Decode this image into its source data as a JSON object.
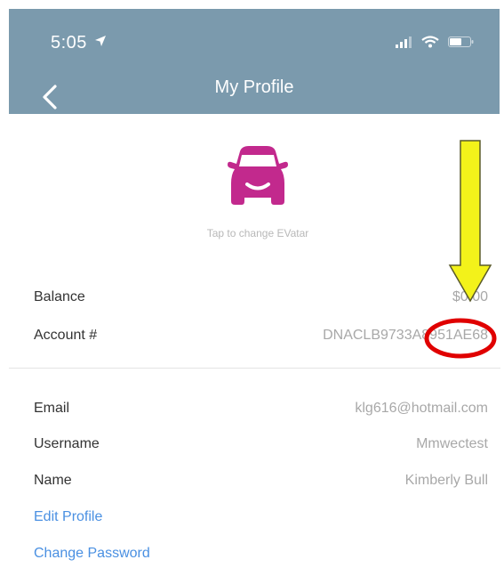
{
  "status_bar": {
    "time": "5:05"
  },
  "nav": {
    "title": "My Profile"
  },
  "avatar": {
    "caption": "Tap to change EVatar"
  },
  "account": {
    "balance_label": "Balance",
    "balance_value": "$0.00",
    "account_label": "Account #",
    "account_value": "DNACLB9733A8951AE68"
  },
  "profile": {
    "email_label": "Email",
    "email_value": "klg616@hotmail.com",
    "username_label": "Username",
    "username_value": "Mmwectest",
    "name_label": "Name",
    "name_value": "Kimberly Bull"
  },
  "actions": {
    "edit_profile": "Edit Profile",
    "change_password": "Change Password"
  },
  "colors": {
    "header_bg": "#7b9aad",
    "accent_link": "#4a90e2",
    "avatar_magenta": "#c2298d",
    "annotation_arrow": "#f3f21a",
    "annotation_circle": "#e00000"
  },
  "icons": {
    "back": "chevron-left-icon",
    "location": "location-arrow-icon",
    "signal": "cellular-signal-icon",
    "wifi": "wifi-icon",
    "battery": "battery-icon",
    "avatar": "car-avatar-icon"
  }
}
